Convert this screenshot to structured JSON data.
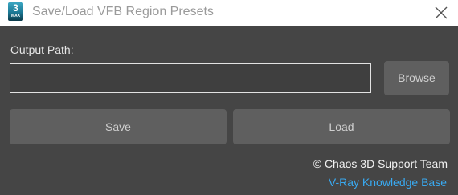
{
  "window": {
    "title": "Save/Load VFB Region Presets",
    "app_icon": {
      "number": "3",
      "caption": "MAX"
    }
  },
  "form": {
    "output_path_label": "Output Path:",
    "output_path_value": "",
    "browse_label": "Browse",
    "save_label": "Save",
    "load_label": "Load"
  },
  "footer": {
    "credit": "© Chaos 3D Support Team",
    "link_text": "V-Ray Knowledge Base"
  },
  "colors": {
    "background": "#454545",
    "titlebar": "#ffffff",
    "button": "#5f5f5f",
    "link": "#39a9f0"
  }
}
